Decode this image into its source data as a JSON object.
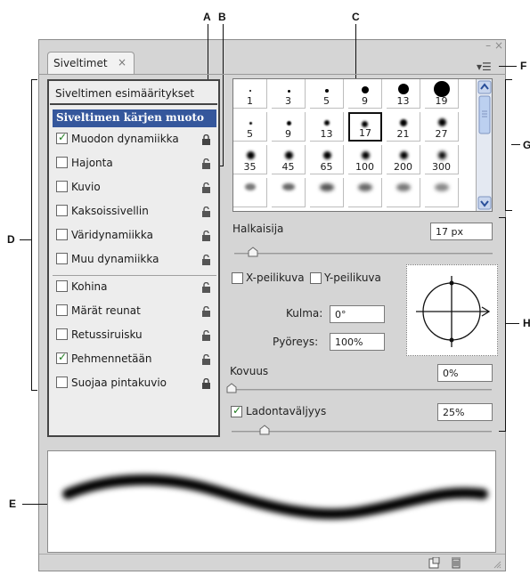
{
  "callouts": {
    "a": "A",
    "b": "B",
    "c": "C",
    "d": "D",
    "e": "E",
    "f": "F",
    "g": "G",
    "h": "H"
  },
  "panel": {
    "tab_title": "Siveltimet",
    "close_glyph": "×",
    "minimize_glyph": "–",
    "panel_close_glyph": "×",
    "flyout_glyph": "▾☰"
  },
  "list": {
    "presets_label": "Siveltimen esimääritykset",
    "items": [
      {
        "label": "Siveltimen kärjen muoto",
        "selected": true
      },
      {
        "label": "Muodon dynamiikka",
        "checked": true,
        "lock": "locked"
      },
      {
        "label": "Hajonta",
        "checked": false,
        "lock": "unlocked"
      },
      {
        "label": "Kuvio",
        "checked": false,
        "lock": "unlocked"
      },
      {
        "label": "Kaksoissivellin",
        "checked": false,
        "lock": "unlocked"
      },
      {
        "label": "Väridynamiikka",
        "checked": false,
        "lock": "unlocked"
      },
      {
        "label": "Muu dynamiikka",
        "checked": false,
        "lock": "unlocked"
      },
      {
        "label": "Kohina",
        "checked": false,
        "lock": "unlocked"
      },
      {
        "label": "Märät reunat",
        "checked": false,
        "lock": "unlocked"
      },
      {
        "label": "Retussiruisku",
        "checked": false,
        "lock": "unlocked"
      },
      {
        "label": "Pehmennetään",
        "checked": true,
        "lock": "unlocked"
      },
      {
        "label": "Suojaa pintakuvio",
        "checked": false,
        "lock": "unlocked"
      }
    ]
  },
  "grid": {
    "rows": [
      [
        "1",
        "3",
        "5",
        "9",
        "13",
        "19"
      ],
      [
        "5",
        "9",
        "13",
        "17",
        "21",
        "27"
      ],
      [
        "35",
        "45",
        "65",
        "100",
        "200",
        "300"
      ]
    ],
    "selected": "17"
  },
  "controls": {
    "diameter_label": "Halkaisija",
    "diameter_value": "17 px",
    "flip_x_label": "X-peilikuva",
    "flip_y_label": "Y-peilikuva",
    "angle_label": "Kulma:",
    "angle_value": "0°",
    "roundness_label": "Pyöreys:",
    "roundness_value": "100%",
    "hardness_label": "Kovuus",
    "hardness_value": "0%",
    "spacing_label": "Ladontaväljyys",
    "spacing_value": "25%",
    "spacing_checked": true
  },
  "colors": {
    "selected_bg": "#35579c",
    "accent": "#2a4f9a"
  },
  "icons": [
    "lock-icon",
    "unlock-icon",
    "new-brush-icon",
    "trash-icon",
    "flyout-menu-icon",
    "scroll-up-icon",
    "scroll-down-icon"
  ]
}
